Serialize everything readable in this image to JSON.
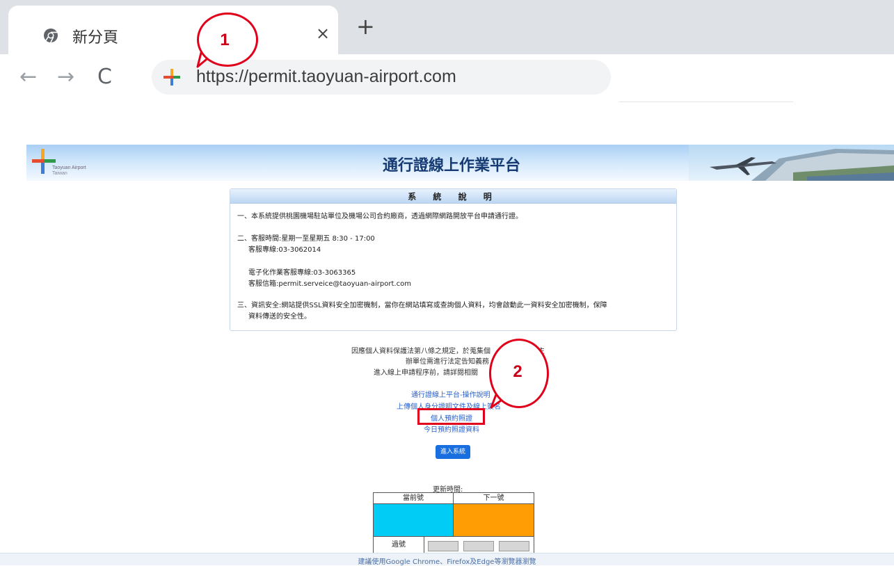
{
  "browser": {
    "tab_title": "新分頁",
    "tab_close": "×",
    "new_tab": "+",
    "nav": {
      "back": "←",
      "forward": "→",
      "reload": "C"
    },
    "url": "https://permit.taoyuan-airport.com"
  },
  "callouts": [
    {
      "label": "1"
    },
    {
      "label": "2"
    }
  ],
  "header": {
    "logo_line1": "Taoyuan Airport",
    "logo_line2": "Taiwan",
    "title": "通行證線上作業平台"
  },
  "system_info": {
    "title": "系 統 說 明",
    "lines": [
      "一、本系統提供桃園機場駐站單位及機場公司合約廠商，透過網際網路開放平台申請通行證。",
      "二、客服時間:星期一至星期五 8:30 - 17:00",
      "客服專線:03-3062014",
      "電子化作業客服專線:03-3063365",
      "客服信箱:permit.serveice@taoyuan-airport.com",
      "三、資訊安全:網站提供SSL資料安全加密機制，當你在網站填寫或查詢個人資料，均會啟動此一資料安全加密機制，保障",
      "資料傳送的安全性。"
    ]
  },
  "notice": {
    "line1": "因應個人資料保護法第八條之規定，於蒐集個",
    "line1_tail": "時主",
    "line2": "辦單位需進行法定告知義務",
    "line3": "進入線上申請程序前，請詳閱相關"
  },
  "links": {
    "manual": "通行證線上平台-操作說明",
    "upload": "上傳個人身分證明文件及線上簽名",
    "reserve_photo": "個人預約照證",
    "today_photo": "今日預約照證資料"
  },
  "enter_button": "進入系統",
  "queue": {
    "update_label": "更新時間:",
    "current_label": "當前號",
    "next_label": "下一號",
    "passed_label": "過號",
    "current_color": "#00ccf5",
    "next_color": "#ff9d05"
  },
  "footer": {
    "text": "建議使用Google Chrome、Firefox及Edge等瀏覽器瀏覽"
  }
}
